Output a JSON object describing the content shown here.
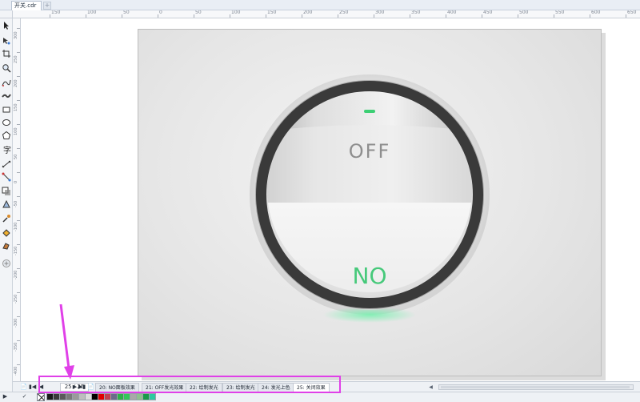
{
  "document": {
    "tab_title": "开关.cdr",
    "new_tab_symbol": "+"
  },
  "ruler": {
    "h_labels": [
      "150",
      "100",
      "50",
      "0",
      "50",
      "100",
      "150",
      "200",
      "250",
      "300",
      "350",
      "400",
      "450",
      "500",
      "550",
      "600",
      "650",
      "700"
    ],
    "v_labels": [
      "300",
      "250",
      "200",
      "150",
      "100",
      "50",
      "0",
      "-50",
      "-100",
      "-150",
      "-200",
      "-250",
      "-300",
      "-350",
      "-400"
    ]
  },
  "toolbox": {
    "tools": [
      "pick-tool-icon",
      "shape-tool-icon",
      "crop-tool-icon",
      "zoom-tool-icon",
      "freehand-tool-icon",
      "artistic-media-icon",
      "rectangle-tool-icon",
      "ellipse-tool-icon",
      "polygon-tool-icon",
      "text-tool-icon",
      "parallel-dimension-icon",
      "connector-tool-icon",
      "drop-shadow-icon",
      "transparency-tool-icon",
      "eyedropper-tool-icon",
      "interactive-fill-icon",
      "smart-fill-icon",
      "add-tool-icon"
    ]
  },
  "artwork": {
    "off_label": "OFF",
    "on_label": "NO",
    "colors": {
      "ring": "#3a3a3a",
      "indicator": "#3ccf74",
      "on_text": "#46c97a",
      "off_text": "#8e8e8e"
    }
  },
  "pagebar": {
    "counter": "25 / 25",
    "tabs": [
      "20: NO面板效果",
      "21: OFF发光效果",
      "22: 绘制发光",
      "23: 绘制发光",
      "24: 发光上色",
      "25: 关闭效果"
    ],
    "active_index": 5
  },
  "palette": {
    "swatches": [
      "#1a1a1a",
      "#3a3a3a",
      "#5a5a5a",
      "#7a7a7a",
      "#9a9a9a",
      "#bdbdbd",
      "#dddddd",
      "#000000",
      "#e00000",
      "#c04050",
      "#6a6a8a",
      "#2fb04a",
      "#34c759",
      "#a8a8a8",
      "#8fbf8f",
      "#1a9a4a",
      "#2cc9a0"
    ]
  },
  "annotation": {
    "color": "#e040e8"
  }
}
